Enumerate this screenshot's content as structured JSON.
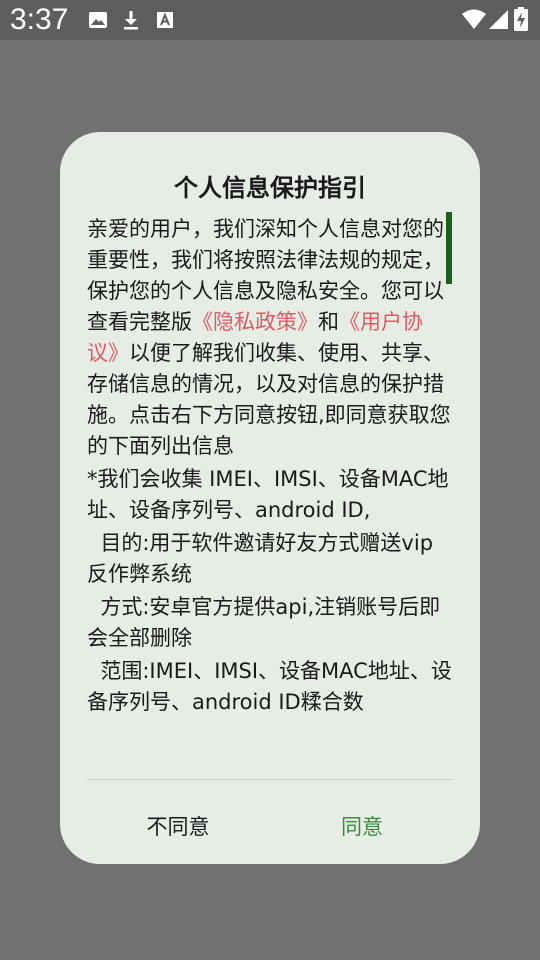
{
  "status_bar": {
    "time": "3:37",
    "icons": [
      "image-icon",
      "download-icon",
      "text-a-icon",
      "wifi-icon",
      "signal-icon",
      "battery-charging-icon"
    ]
  },
  "dialog": {
    "title": "个人信息保护指引",
    "intro_before_privacy": "亲爱的用户，我们深知个人信息对您的重要性，我们将按照法律法规的规定，保护您的个人信息及隐私安全。您可以查看完整版",
    "privacy_link": "《隐私政策》",
    "between_links": "和",
    "user_agreement_link": "《用户协议》",
    "intro_after_links": "以便了解我们收集、使用、共享、存储信息的情况，以及对信息的保护措施。点击右下方同意按钮,即同意获取您的下面列出信息",
    "collect_line": "*我们会收集 IMEI、IMSI、设备MAC地址、设备序列号、android ID,",
    "purpose_line": "  目的:用于软件邀请好友方式赠送vip反作弊系统",
    "method_line": "  方式:安卓官方提供api,注销账号后即会全部删除",
    "scope_line": "  范围:IMEI、IMSI、设备MAC地址、设备序列号、android ID糅合数",
    "disagree_label": "不同意",
    "agree_label": "同意"
  },
  "colors": {
    "overlay": "#717171",
    "dialog_bg": "#e5ede5",
    "link": "#e05a62",
    "agree": "#3d8b40",
    "scroll_thumb": "#1b5e20"
  }
}
